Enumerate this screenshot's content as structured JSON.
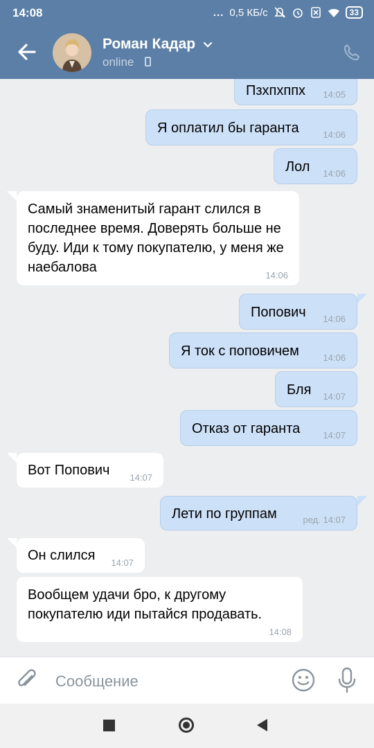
{
  "status_bar": {
    "time": "14:08",
    "dots": "...",
    "network_speed": "0,5 КБ/с",
    "battery": "33"
  },
  "header": {
    "contact_name": "Роман Кадар",
    "contact_status": "online",
    "accent_color": "#5b7fa6"
  },
  "messages": [
    {
      "direction": "out",
      "text": "Пзхпхппх",
      "time": "14:05"
    },
    {
      "direction": "out",
      "text": "Я оплатил бы гаранта",
      "time": "14:06"
    },
    {
      "direction": "out",
      "text": "Лол",
      "time": "14:06"
    },
    {
      "direction": "in",
      "text": "Самый знаменитый гарант слился в последнее время. Доверять больше не буду. Иди к тому покупателю, у меня же наебалова",
      "time": "14:06"
    },
    {
      "direction": "out",
      "text": "Попович",
      "time": "14:06"
    },
    {
      "direction": "out",
      "text": "Я ток с поповичем",
      "time": "14:06"
    },
    {
      "direction": "out",
      "text": "Бля",
      "time": "14:07"
    },
    {
      "direction": "out",
      "text": "Отказ от гаранта",
      "time": "14:07"
    },
    {
      "direction": "in",
      "text": "Вот Попович",
      "time": "14:07"
    },
    {
      "direction": "out",
      "text": "Лети по группам",
      "time": "ред. 14:07"
    },
    {
      "direction": "in",
      "text": "Он слился",
      "time": "14:07"
    },
    {
      "direction": "in",
      "text": "Вообщем удачи бро, к другому покупателю иди пытайся продавать.",
      "time": "14:08"
    }
  ],
  "input": {
    "placeholder": "Сообщение"
  },
  "colors": {
    "outgoing_bubble": "#cce0f8",
    "incoming_bubble": "#ffffff",
    "chat_background": "#edeef0"
  },
  "icons": {
    "back": "arrow-left-icon",
    "call": "phone-icon",
    "attach": "paperclip-icon",
    "emoji": "smile-icon",
    "mic": "microphone-icon"
  }
}
